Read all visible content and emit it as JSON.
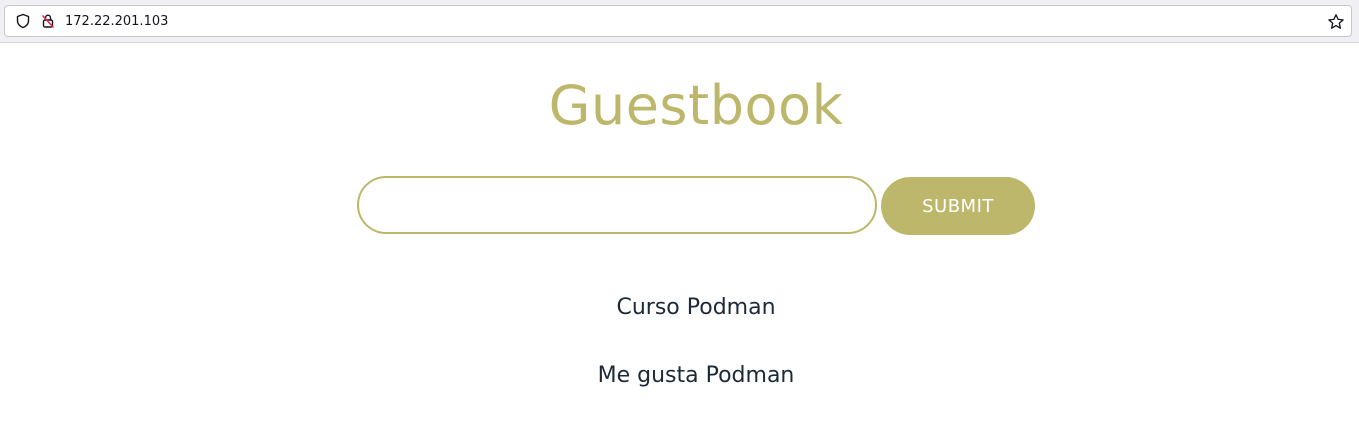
{
  "browser": {
    "url": "172.22.201.103",
    "icons": {
      "tracking_protection": "shield-icon",
      "insecure_connection": "lock-strike-icon",
      "bookmark": "star-icon"
    }
  },
  "page": {
    "title": "Guestbook",
    "input": {
      "value": "",
      "placeholder": ""
    },
    "submit_label": "SUBMIT",
    "entries": [
      "Curso Podman",
      "Me gusta Podman"
    ]
  },
  "colors": {
    "accent": "#bdb76b",
    "text": "#1c2a38",
    "background": "#ffffff"
  }
}
